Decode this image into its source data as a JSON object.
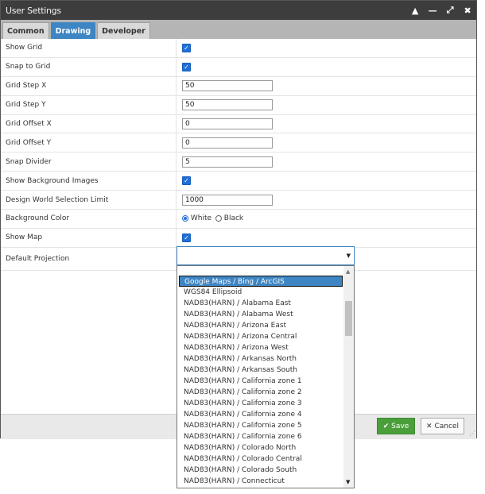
{
  "window": {
    "title": "User Settings",
    "controls": {
      "collapse": "▲",
      "minimize": "—",
      "maximize": "⤢",
      "close": "✖"
    }
  },
  "tabs": [
    {
      "label": "Common",
      "active": false
    },
    {
      "label": "Drawing",
      "active": true
    },
    {
      "label": "Developer",
      "active": false
    }
  ],
  "settings": {
    "show_grid": {
      "label": "Show Grid",
      "checked": true
    },
    "snap_to_grid": {
      "label": "Snap to Grid",
      "checked": true
    },
    "grid_step_x": {
      "label": "Grid Step X",
      "value": "50"
    },
    "grid_step_y": {
      "label": "Grid Step Y",
      "value": "50"
    },
    "grid_offset_x": {
      "label": "Grid Offset X",
      "value": "0"
    },
    "grid_offset_y": {
      "label": "Grid Offset Y",
      "value": "0"
    },
    "snap_divider": {
      "label": "Snap Divider",
      "value": "5"
    },
    "show_bg_images": {
      "label": "Show Background Images",
      "checked": true
    },
    "dw_selection_limit": {
      "label": "Design World Selection Limit",
      "value": "1000"
    },
    "background_color": {
      "label": "Background Color",
      "options": [
        "White",
        "Black"
      ],
      "selected": "White"
    },
    "show_map": {
      "label": "Show Map",
      "checked": true
    },
    "default_projection": {
      "label": "Default Projection",
      "value": ""
    }
  },
  "projection_options": [
    "Google Maps / Bing / ArcGIS",
    "WGS84 Ellipsoid",
    "NAD83(HARN) / Alabama East",
    "NAD83(HARN) / Alabama West",
    "NAD83(HARN) / Arizona East",
    "NAD83(HARN) / Arizona Central",
    "NAD83(HARN) / Arizona West",
    "NAD83(HARN) / Arkansas North",
    "NAD83(HARN) / Arkansas South",
    "NAD83(HARN) / California zone 1",
    "NAD83(HARN) / California zone 2",
    "NAD83(HARN) / California zone 3",
    "NAD83(HARN) / California zone 4",
    "NAD83(HARN) / California zone 5",
    "NAD83(HARN) / California zone 6",
    "NAD83(HARN) / Colorado North",
    "NAD83(HARN) / Colorado Central",
    "NAD83(HARN) / Colorado South",
    "NAD83(HARN) / Connecticut"
  ],
  "highlighted_option": "Google Maps / Bing / ArcGIS",
  "buttons": {
    "save": "Save",
    "cancel": "Cancel"
  },
  "colors": {
    "accent": "#3e85c3",
    "save": "#4a9f3a",
    "titlebar": "#3d3d3d"
  }
}
